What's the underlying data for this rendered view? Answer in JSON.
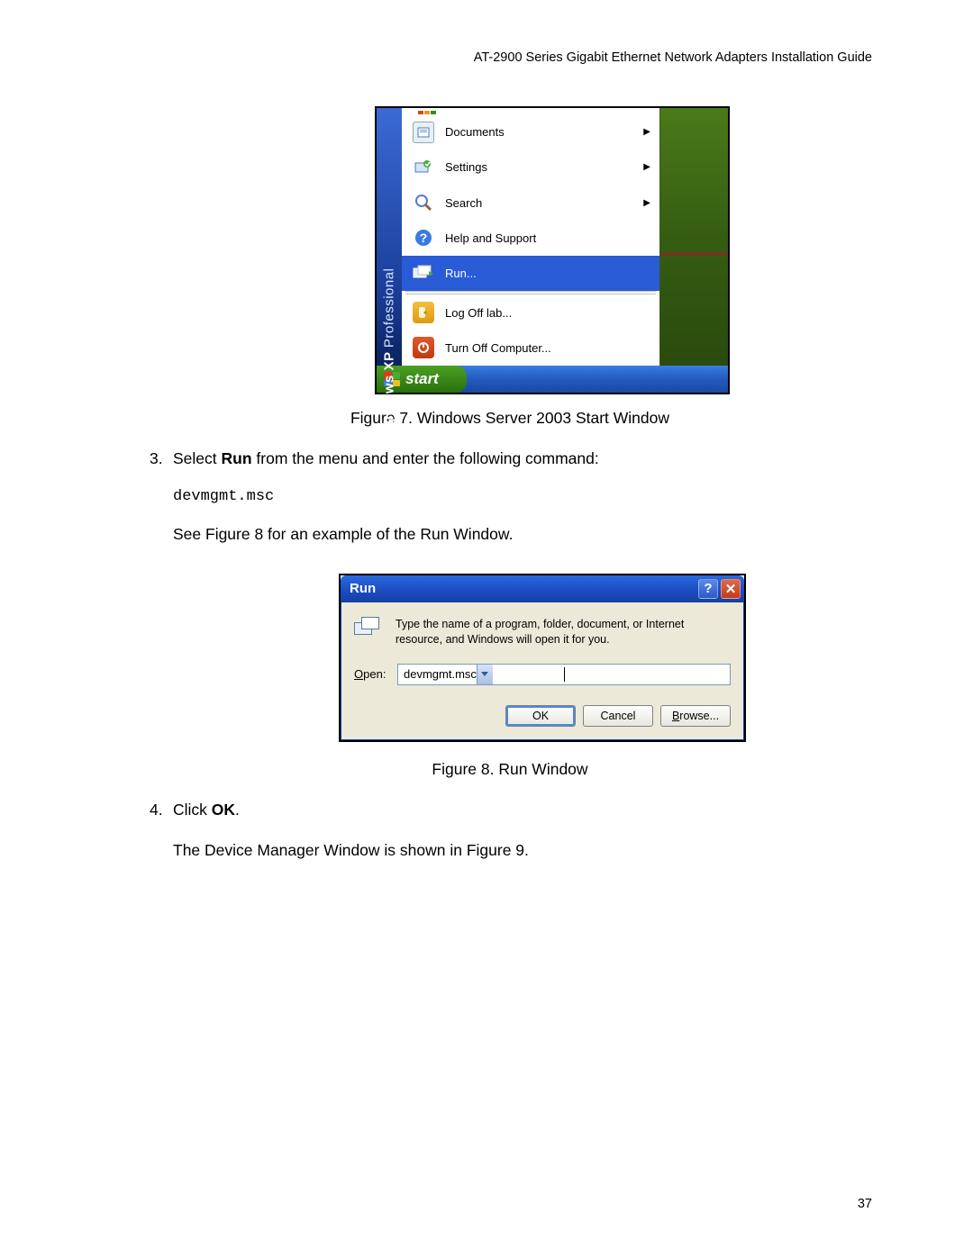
{
  "header": "AT-2900 Series Gigabit Ethernet Network Adapters Installation Guide",
  "page_number": "37",
  "figure1": {
    "banner_main": "Windows XP",
    "banner_sub": "Professional",
    "menu": [
      {
        "label": "Documents",
        "arrow": true,
        "icon": "documents"
      },
      {
        "label": "Settings",
        "arrow": true,
        "icon": "settings"
      },
      {
        "label": "Search",
        "arrow": true,
        "icon": "search"
      },
      {
        "label": "Help and Support",
        "arrow": false,
        "icon": "help"
      },
      {
        "label": "Run...",
        "arrow": false,
        "icon": "run",
        "highlight": true
      },
      {
        "label": "Log Off lab...",
        "arrow": false,
        "icon": "logoff"
      },
      {
        "label": "Turn Off Computer...",
        "arrow": false,
        "icon": "shutdown"
      }
    ],
    "start_label": "start",
    "caption": "Figure 7. Windows Server 2003 Start Window"
  },
  "steps": {
    "s3_num": "3.",
    "s3_text_pre": "Select ",
    "s3_text_bold": "Run",
    "s3_text_post": " from the menu and enter the following command:",
    "s3_cmd": "devmgmt.msc",
    "s3_para": "See Figure 8 for an example of the Run Window.",
    "s4_num": "4.",
    "s4_text_pre": "Click ",
    "s4_text_bold": "OK",
    "s4_text_post": ".",
    "s4_para": "The Device Manager Window is shown in Figure 9."
  },
  "figure2": {
    "title": "Run",
    "description": "Type the name of a program, folder, document, or Internet resource, and Windows will open it for you.",
    "open_label": "Open:",
    "input_value": "devmgmt.msc",
    "buttons": {
      "ok": "OK",
      "cancel": "Cancel",
      "browse": "Browse..."
    },
    "caption": "Figure 8. Run Window"
  }
}
